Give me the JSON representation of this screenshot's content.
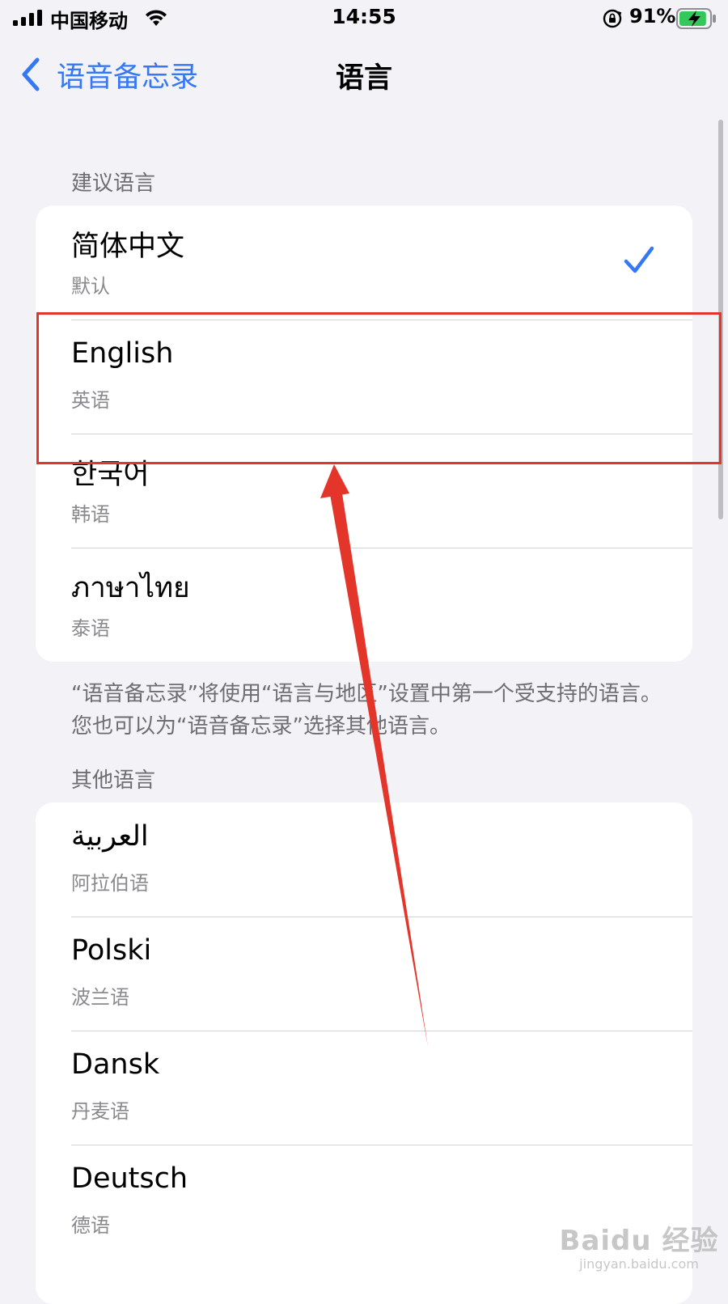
{
  "status_bar": {
    "carrier": "中国移动",
    "time": "14:55",
    "battery_percent": "91%",
    "signal_bars": 4,
    "battery_level": 0.91,
    "battery_charging": true
  },
  "nav": {
    "back_label": "语音备忘录",
    "title": "语言"
  },
  "colors": {
    "accent": "#3478f6",
    "annotation": "#e4352a",
    "background": "#f2f2f7"
  },
  "suggested": {
    "header": "建议语言",
    "items": [
      {
        "primary": "简体中文",
        "secondary": "默认",
        "selected": true
      },
      {
        "primary": "English",
        "secondary": "英语",
        "selected": false
      },
      {
        "primary": "한국어",
        "secondary": "韩语",
        "selected": false
      },
      {
        "primary": "ภาษาไทย",
        "secondary": "泰语",
        "selected": false
      }
    ],
    "footer": "“语音备忘录”将使用“语言与地区”设置中第一个受支持的语言。您也可以为“语音备忘录”选择其他语言。"
  },
  "other": {
    "header": "其他语言",
    "items": [
      {
        "primary": "العربية",
        "secondary": "阿拉伯语"
      },
      {
        "primary": "Polski",
        "secondary": "波兰语"
      },
      {
        "primary": "Dansk",
        "secondary": "丹麦语"
      },
      {
        "primary": "Deutsch",
        "secondary": "德语"
      }
    ]
  },
  "watermark": {
    "main": "Baidu 经验",
    "sub": "jingyan.baidu.com"
  }
}
